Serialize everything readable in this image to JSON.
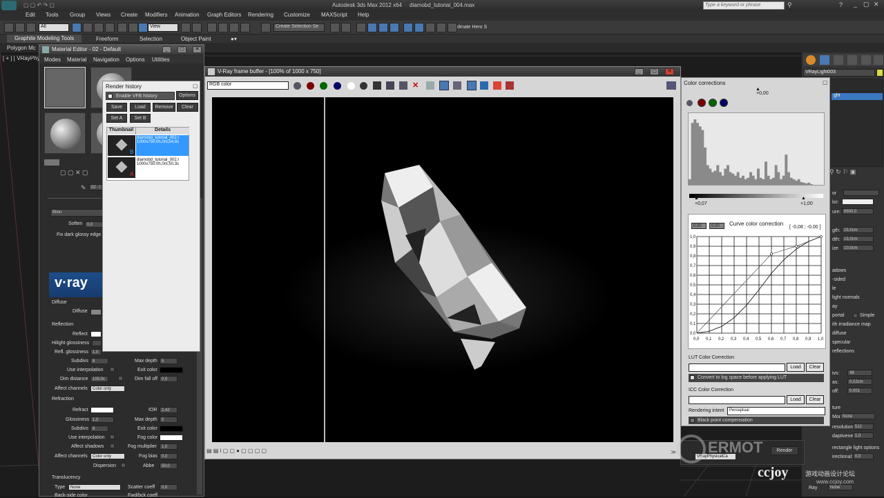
{
  "app_title": "Autodesk 3ds Max 2012 x64",
  "file_name": "diamobd_tutorial_004.max",
  "search_placeholder": "Type a keyword or phrase",
  "menus": [
    "Edit",
    "Tools",
    "Group",
    "Views",
    "Create",
    "Modifiers",
    "Animation",
    "Graph Editors",
    "Rendering",
    "Customize",
    "MAXScript",
    "Help"
  ],
  "toolbar": {
    "filter": "All",
    "refcoord": "View",
    "selset": "Create Selection Se",
    "hero": "dmate Hero S"
  },
  "ribbon_tabs": [
    "Graphite Modeling Tools",
    "Freeform",
    "Selection",
    "Object Paint"
  ],
  "poly_label": "Polygon Mc",
  "viewport_label": "[ + ] [ VRayPhy",
  "colors": {
    "accent": "#3399ff",
    "viewport_bg": "#1c1c1c"
  },
  "mat_editor": {
    "title": "Material Editor - 02 - Default",
    "menus": [
      "Modes",
      "Material",
      "Navigation",
      "Options",
      "Utilities"
    ],
    "mat_name": "02 - I",
    "shader": "Blinn",
    "soften_label": "Soften",
    "soften_value": "0,0",
    "fix_dark_label": "Fix dark glossy edge",
    "vray_logo": "v·ray",
    "diffuse_group": "Diffuse",
    "diffuse_label": "Diffuse",
    "reflection_group": "Reflection",
    "reflect_label": "Reflect",
    "hilight_label": "Hilight glossiness",
    "refl_gloss_label": "Refl. glossiness",
    "refl_gloss_value": "1,0",
    "subdivs_label": "Subdivs",
    "subdivs_value": "8",
    "use_interp_label": "Use interpolation",
    "dim_dist_label": "Dim distance",
    "dim_dist_value": "100,0c",
    "affect_channels_label": "Affect channels",
    "affect_channels_value": "Color only",
    "max_depth_label": "Max depth",
    "max_depth_value": "5",
    "exit_color_label": "Exit color",
    "dim_falloff_label": "Dim fall off",
    "dim_falloff_value": "0,0",
    "refraction_group": "Refraction",
    "refract_label": "Refract",
    "ior_label": "IOR",
    "ior_value": "2,42",
    "glossiness_label": "Glossiness",
    "glossiness_value": "1,0",
    "r_max_depth_value": "5",
    "r_subdivs_value": "8",
    "r_exit_label": "Exit color",
    "r_use_interp_label": "Use interpolation",
    "fog_color_label": "Fog color",
    "affect_shadows_label": "Affect shadows",
    "fog_mult_label": "Fog multiplier",
    "fog_mult_value": "1,0",
    "r_affect_label": "Affect channels",
    "r_affect_value": "Color only",
    "fog_bias_label": "Fog bias",
    "fog_bias_value": "0,0",
    "dispersion_label": "Dispersion",
    "abbe_label": "Abbe",
    "abbe_value": "50,0",
    "translucency_group": "Translucency",
    "type_label": "Type",
    "type_value": "None",
    "scatter_label": "Scatter coeff",
    "scatter_value": "0,0",
    "back_side_label": "Back-side color",
    "fwd_bck_label": "Fwd/bck coeff"
  },
  "render_history": {
    "title": "Render history",
    "enable_label": "Enable VFB history",
    "options_label": "Options",
    "save_label": "Save",
    "load_label": "Load",
    "remove_label": "Remove",
    "clear_label": "Clear",
    "seta_label": "Set A",
    "setb_label": "Set B",
    "col_thumb": "Thumbnail",
    "col_details": "Details",
    "rows": [
      {
        "name": "diamobd_tutorial_002.r",
        "info": "1000x750;0h,0m,54,8s",
        "badge": "B"
      },
      {
        "name": "diamobd_tutorial_002.r",
        "info": "1000x750;0h,0m,50,3s",
        "badge": "A"
      }
    ]
  },
  "vfb": {
    "title": "V-Ray frame buffer - [100% of 1000 x 750]",
    "channel": "RGB color"
  },
  "cc": {
    "title": "Color corrections",
    "top_value": "+0,00",
    "lev_low": "+0,07",
    "lev_high": "+1,00",
    "curve_title": "Curve color correction",
    "curve_readout": "[ -0,08 ; -0,00 ]",
    "curve_box1": "0,00",
    "curve_box2": "0,00",
    "y_ticks": [
      "1,0",
      "0,9",
      "0,8",
      "0,7",
      "0,6",
      "0,5",
      "0,4",
      "0,3",
      "0,2",
      "0,1",
      "0,0"
    ],
    "x_ticks": [
      "0,0",
      "0,1",
      "0,2",
      "0,3",
      "0,4",
      "0,5",
      "0,6",
      "0,7",
      "0,8",
      "0,9",
      "1,0"
    ],
    "lut_title": "LUT Color Correction",
    "lut_load": "Load",
    "lut_clear": "Clear",
    "lut_log_label": "Convert to log space before applying LUT",
    "icc_title": "ICC Color Correction",
    "icc_load": "Load",
    "icc_clear": "Clear",
    "intent_label": "Rendering intent",
    "intent_value": "Perceptual",
    "bpc_label": "Black point compensation"
  },
  "command_panel": {
    "object_name": "VRayLight003",
    "light_item": "ght",
    "labels": [
      "or",
      "lor:",
      "ure:",
      "gth:",
      "dth:",
      "ize",
      "adows",
      "-sided",
      "le",
      "light normals",
      "ay",
      "portal",
      "Simple",
      "ith irradiance map",
      "diffuse",
      "specular",
      "reflections",
      "ivs:",
      "as:",
      "off:",
      "ture",
      "Mode",
      "resolution:",
      "daptiveness:",
      "rectangle light options",
      "irectional:"
    ],
    "values": {
      "len": "15,0cm",
      "wid": "15,0cm",
      "siz": "10,0cm",
      "temp": "6500,0",
      "subdivs": "48",
      "bias": "0,02cm",
      "cutoff": "0,001",
      "mode": "None",
      "res": "512",
      "adapt": "1,0",
      "dir": "0,0"
    }
  },
  "bottom": {
    "camera": "VRayPhysicalCa",
    "render": "Render",
    "none_field": "None",
    "ray": "Ray"
  },
  "watermarks": {
    "w1": "ERMOT",
    "w2": "ccjoy",
    "w3": "游戏动画设计论坛",
    "w4": "www.ccjoy.com"
  },
  "curve_points": [
    [
      0,
      0
    ],
    [
      0.1,
      0.02
    ],
    [
      0.2,
      0.07
    ],
    [
      0.3,
      0.16
    ],
    [
      0.4,
      0.29
    ],
    [
      0.5,
      0.45
    ],
    [
      0.6,
      0.62
    ],
    [
      0.7,
      0.76
    ],
    [
      0.8,
      0.87
    ],
    [
      0.9,
      0.95
    ],
    [
      1,
      1
    ]
  ],
  "curve_ref_points": [
    [
      0,
      0
    ],
    [
      0.6,
      0.82
    ],
    [
      0.8,
      0.9
    ],
    [
      1,
      1
    ]
  ],
  "histogram": [
    0.1,
    0.9,
    0.95,
    0.9,
    0.85,
    0.8,
    0.55,
    0.3,
    0.25,
    0.2,
    0.22,
    0.3,
    0.2,
    0.15,
    0.25,
    0.3,
    0.2,
    0.18,
    0.15,
    0.2,
    0.12,
    0.15,
    0.1,
    0.12,
    0.2,
    0.15,
    0.1,
    0.25,
    0.12,
    0.1,
    0.35,
    0.15,
    0.1,
    0.12,
    0.3,
    0.2,
    0.1,
    0.15,
    0.45,
    0.2,
    0.12,
    0.1,
    0.08,
    0.1,
    0.06,
    0.05,
    0.04,
    0.05,
    0.03,
    0.02,
    0.02,
    0.02,
    0.01,
    0.01
  ]
}
